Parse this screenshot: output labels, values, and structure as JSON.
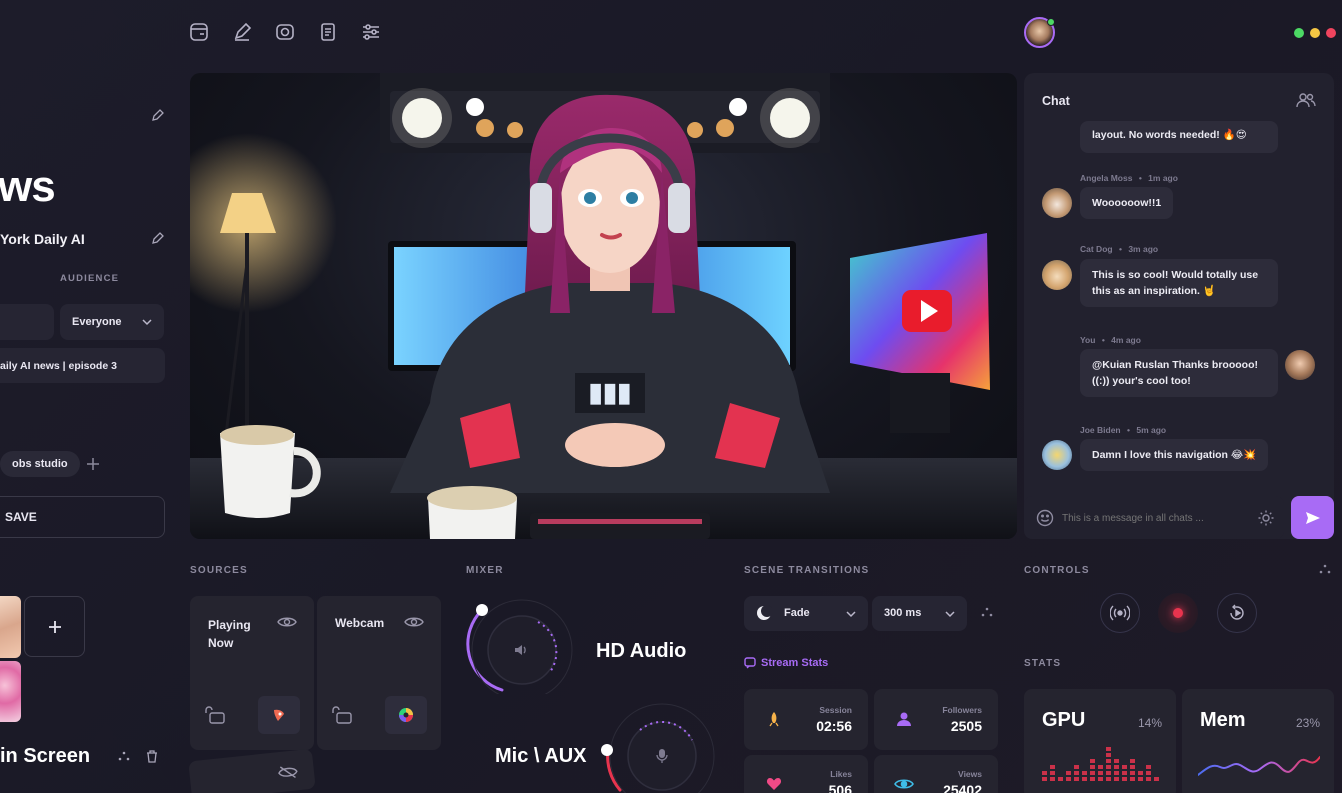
{
  "left": {
    "title_fragment": "ws",
    "channel_name": "York Daily AI",
    "audience_label": "AUDIENCE",
    "audience_value": "Everyone",
    "episode_title": "aily AI news | episode 3",
    "tag": "obs studio",
    "save_label": "SAVE",
    "scene_name": "in Screen"
  },
  "chat": {
    "title": "Chat",
    "messages": [
      {
        "author": "",
        "time": "",
        "text": "layout. No words needed! 🔥😍"
      },
      {
        "author": "Angela Moss",
        "time": "1m ago",
        "text": "Woooooow!!1"
      },
      {
        "author": "Cat Dog",
        "time": "3m ago",
        "text": "This is so cool! Would totally use this as an inspiration. 🤘"
      },
      {
        "author": "You",
        "time": "4m ago",
        "text": "@Kuian Ruslan Thanks brooooo! ((:)) your's cool too!"
      },
      {
        "author": "Joe Biden",
        "time": "5m ago",
        "text": "Damn I love this navigation 😂💥"
      }
    ],
    "input_placeholder": "This is a message in all chats ..."
  },
  "sources": {
    "title": "SOURCES",
    "items": [
      {
        "label": "Playing Now"
      },
      {
        "label": "Webcam"
      }
    ]
  },
  "mixer": {
    "title": "MIXER",
    "channels": [
      {
        "label": "HD Audio"
      },
      {
        "label": "Mic \\ AUX"
      }
    ]
  },
  "transitions": {
    "title": "SCENE TRANSITIONS",
    "type": "Fade",
    "duration": "300 ms",
    "stream_stats_label": "Stream Stats",
    "stats": [
      {
        "label": "Session",
        "value": "02:56"
      },
      {
        "label": "Followers",
        "value": "2505"
      },
      {
        "label": "Likes",
        "value": "506"
      },
      {
        "label": "Views",
        "value": "25402"
      }
    ]
  },
  "controls": {
    "title": "CONTROLS",
    "stats_title": "STATS",
    "gpu": {
      "label": "GPU",
      "percent": "14%"
    },
    "mem": {
      "label": "Mem",
      "percent": "23%"
    }
  },
  "colors": {
    "accent": "#a86bf5",
    "record": "#e8344e",
    "online": "#4cd964"
  }
}
